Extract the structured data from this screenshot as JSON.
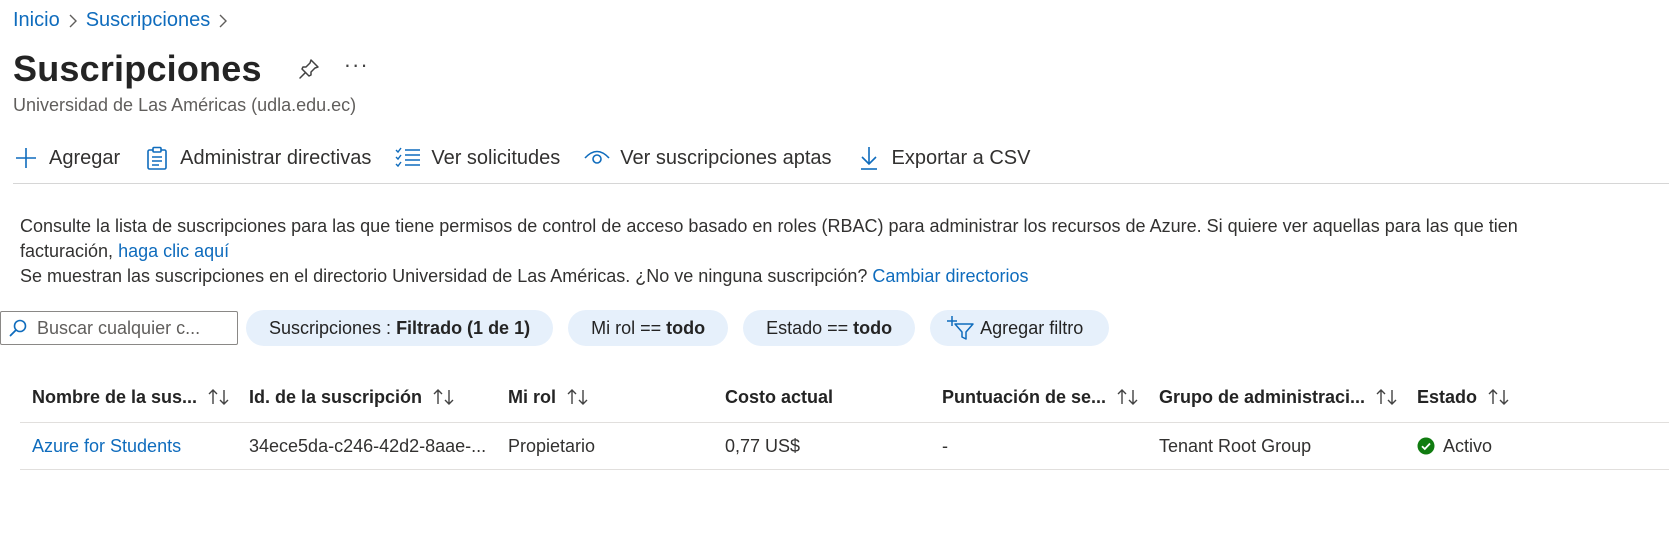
{
  "breadcrumb": {
    "items": [
      "Inicio",
      "Suscripciones"
    ]
  },
  "header": {
    "title": "Suscripciones",
    "more": "···",
    "subtitle": "Universidad de Las Américas (udla.edu.ec)"
  },
  "toolbar": {
    "add_label": "Agregar",
    "policies_label": "Administrar directivas",
    "requests_label": "Ver solicitudes",
    "eligible_label": "Ver suscripciones aptas",
    "export_label": "Exportar a CSV"
  },
  "description": {
    "line1": "Consulte la lista de suscripciones para las que tiene permisos de control de acceso basado en roles (RBAC) para administrar los recursos de Azure. Si quiere ver aquellas para las que tien",
    "line2_prefix": "facturación, ",
    "line2_link": "haga clic aquí",
    "line3": "Se muestran las suscripciones en el directorio Universidad de Las Américas. ¿No ve ninguna suscripción? ",
    "line3_link": "Cambiar directorios"
  },
  "filters": {
    "search_placeholder": "Buscar cualquier c...",
    "subscriptions_label": "Suscripciones : ",
    "subscriptions_value": "Filtrado (1 de 1)",
    "role_label": "Mi rol == ",
    "role_value": "todo",
    "status_label": "Estado == ",
    "status_value": "todo",
    "add_filter_label": "Agregar filtro"
  },
  "table": {
    "columns": [
      "Nombre de la sus...",
      "Id. de la suscripción",
      "Mi rol",
      "Costo actual",
      "Puntuación de se...",
      "Grupo de administraci...",
      "Estado"
    ],
    "rows": [
      {
        "name": "Azure for Students",
        "id": "34ece5da-c246-42d2-8aae-...",
        "role": "Propietario",
        "cost": "0,77 US$",
        "score": "-",
        "group": "Tenant Root Group",
        "status": "Activo"
      }
    ]
  },
  "colors": {
    "link": "#0f6cbd",
    "pill_bg": "#e6f0fb",
    "success": "#107c10"
  }
}
